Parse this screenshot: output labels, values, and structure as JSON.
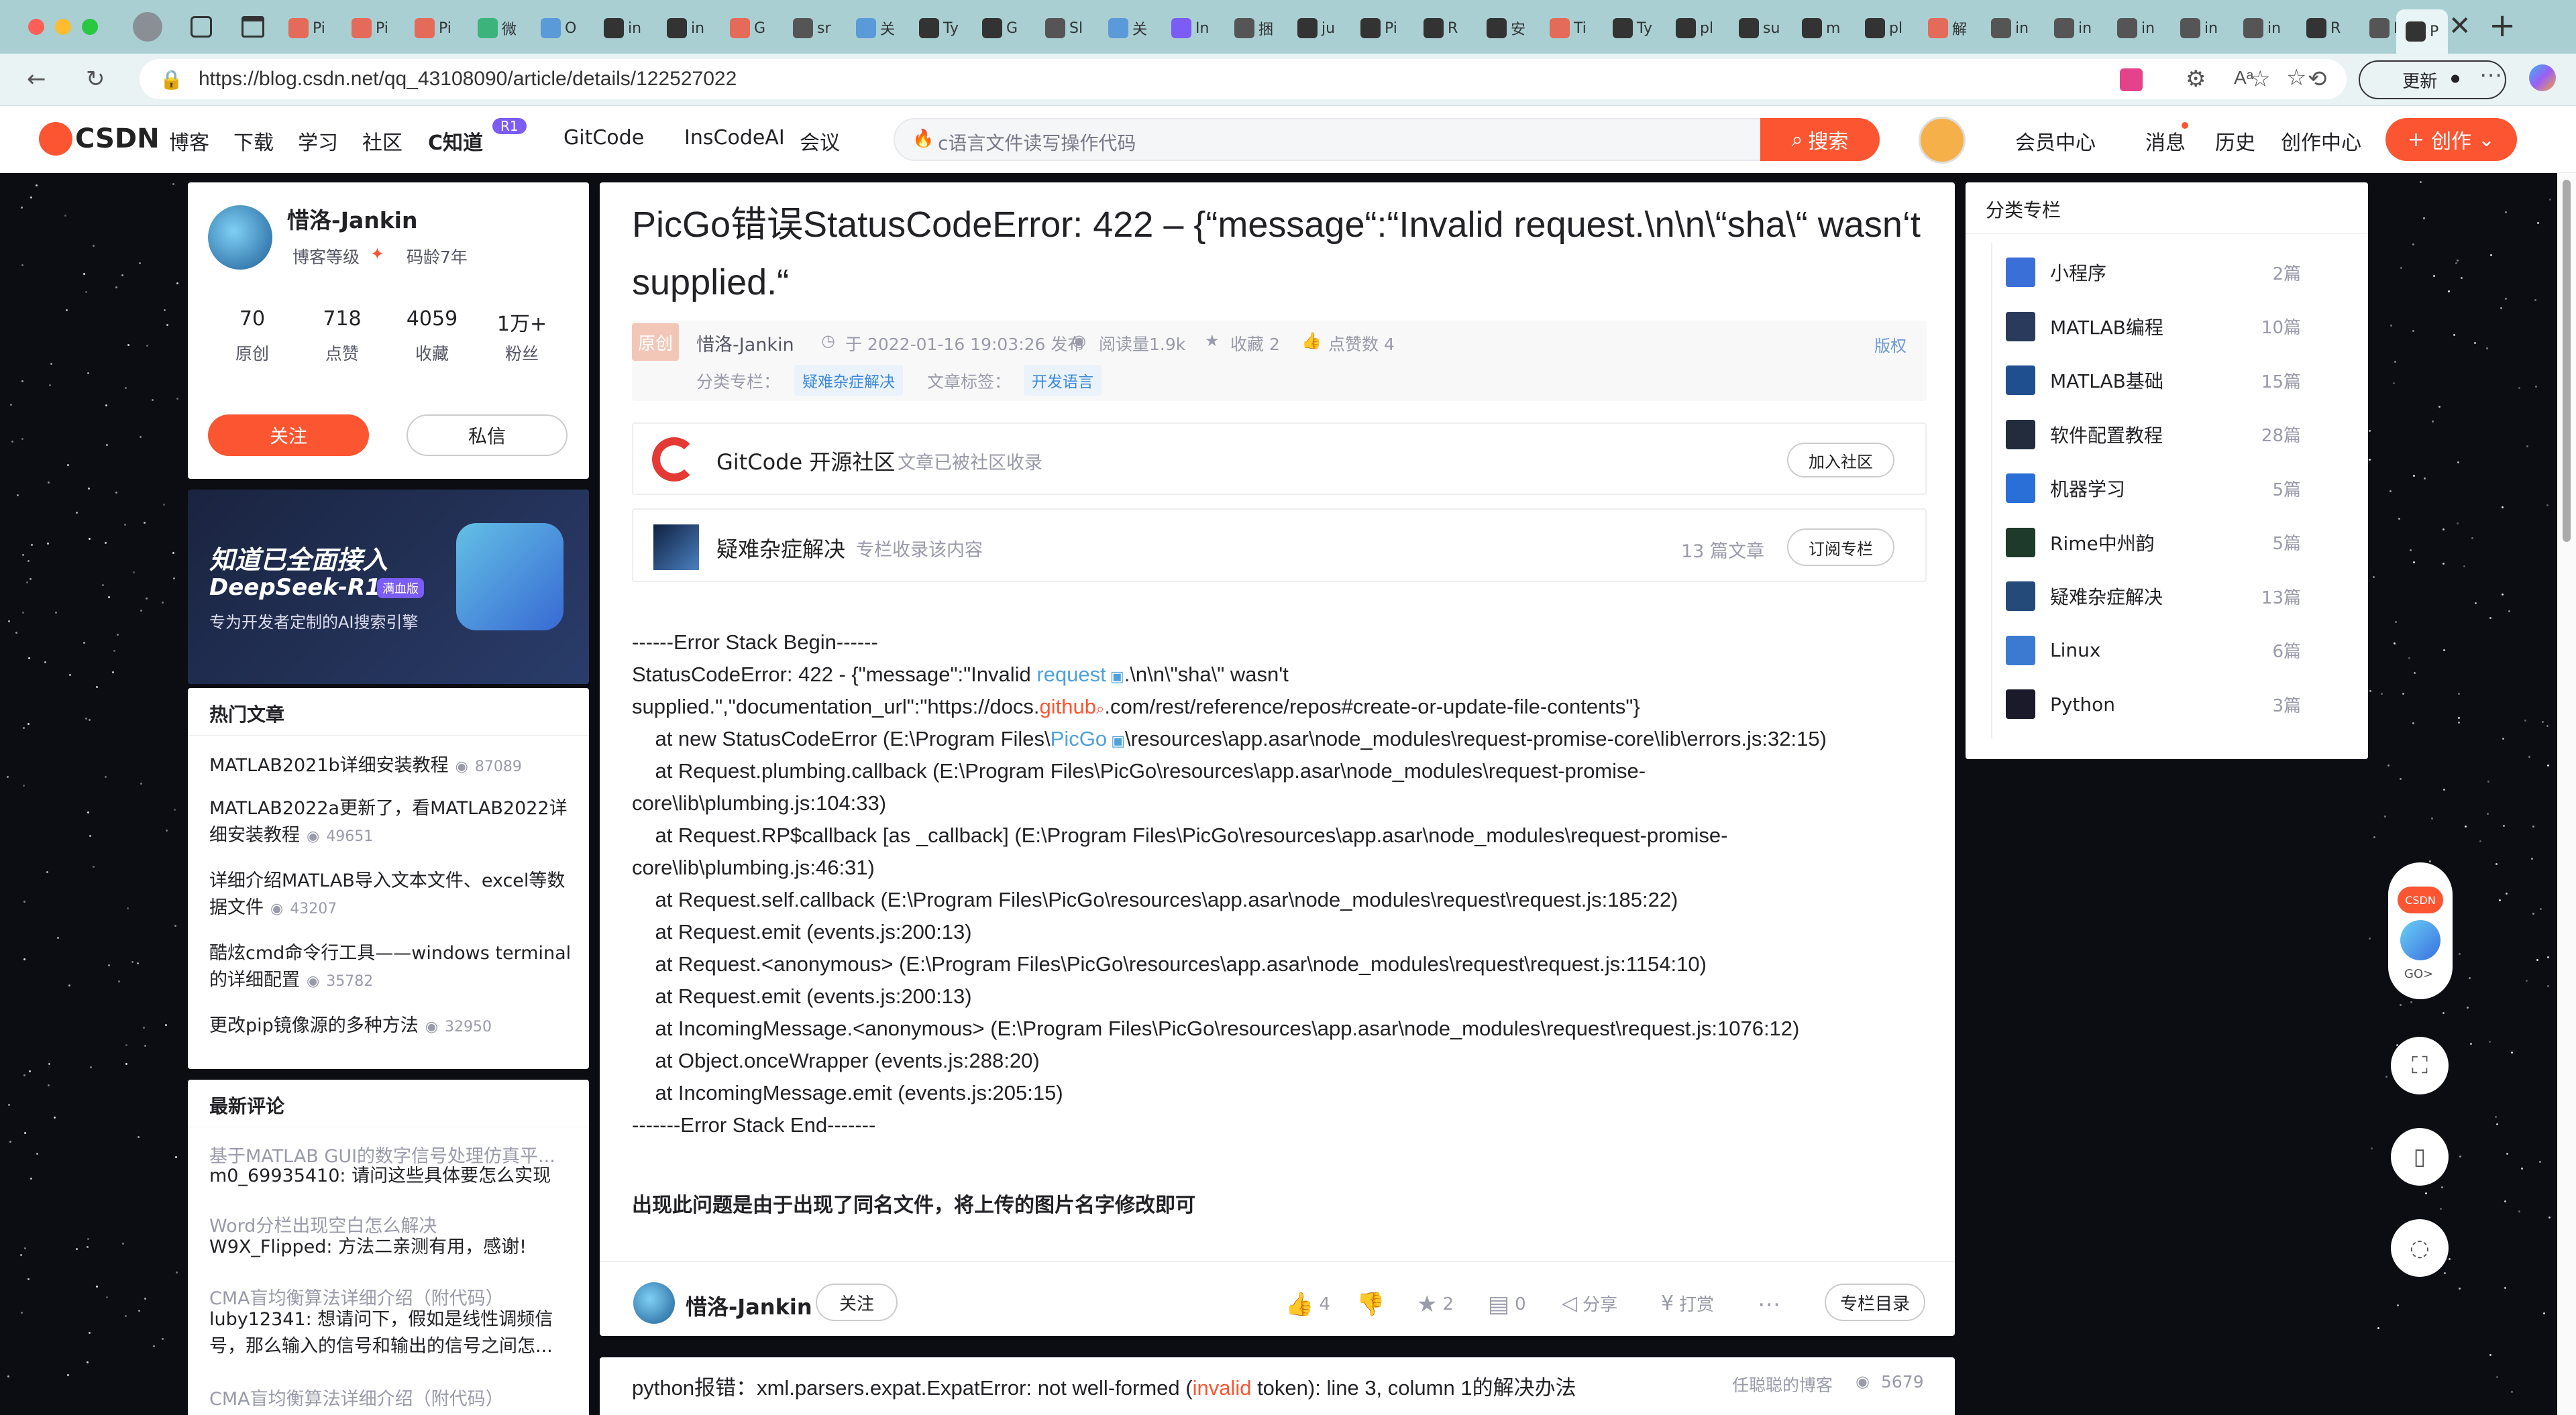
{
  "browser": {
    "tabs": [
      "Pi",
      "Pi",
      "Pi",
      "微",
      "O",
      "in",
      "in",
      "G",
      "sr",
      "关",
      "Ty",
      "G",
      "Sl",
      "关",
      "In",
      "捆",
      "ju",
      "Pi",
      "R",
      "安",
      "Ti",
      "Ty",
      "pl",
      "su",
      "m",
      "pl",
      "解",
      "in",
      "in",
      "in",
      "in",
      "in",
      "R",
      "In",
      "P"
    ],
    "url": "https://blog.csdn.net/qq_43108090/article/details/122527022",
    "update_label": "更新"
  },
  "toolbar": {
    "logo": "CSDN",
    "nav": [
      "博客",
      "下载",
      "学习",
      "社区",
      "C知道",
      "GitCode",
      "InsCodeAI",
      "会议"
    ],
    "r1_badge": "R1",
    "search_placeholder": "c语言文件读写操作代码",
    "search_btn": "搜索",
    "right": [
      "会员中心",
      "消息",
      "历史",
      "创作中心"
    ],
    "create_btn": "创作"
  },
  "profile": {
    "name": "惜洛-Jankin",
    "level": "博客等级",
    "age": "码龄7年",
    "stats": [
      {
        "num": "70",
        "label": "原创"
      },
      {
        "num": "718",
        "label": "点赞"
      },
      {
        "num": "4059",
        "label": "收藏"
      },
      {
        "num": "1万+",
        "label": "粉丝"
      }
    ],
    "follow": "关注",
    "message": "私信"
  },
  "ad": {
    "line1": "知道已全面接入",
    "line2": "DeepSeek-R1",
    "badge": "满血版",
    "line3": "专为开发者定制的AI搜索引擎"
  },
  "hot": {
    "title": "热门文章",
    "items": [
      {
        "title": "MATLAB2021b详细安装教程",
        "views": "87089"
      },
      {
        "title": "MATLAB2022a更新了，看MATLAB2022详细安装教程",
        "views": "49651"
      },
      {
        "title": "详细介绍MATLAB导入文本文件、excel等数据文件",
        "views": "43207"
      },
      {
        "title": "酷炫cmd命令行工具——windows terminal的详细配置",
        "views": "35782"
      },
      {
        "title": "更改pip镜像源的多种方法",
        "views": "32950"
      }
    ]
  },
  "comments": {
    "title": "最新评论",
    "items": [
      {
        "article": "基于MATLAB GUI的数字信号处理仿真平...",
        "text": "m0_69935410: 请问这些具体要怎么实现"
      },
      {
        "article": "Word分栏出现空白怎么解决",
        "text": "W9X_Flipped: 方法二亲测有用，感谢!"
      },
      {
        "article": "CMA盲均衡算法详细介绍（附代码）",
        "text": "luby12341: 想请问下，假如是线性调频信号，那么输入的信号和输出的信号之间怎..."
      },
      {
        "article": "CMA盲均衡算法详细介绍（附代码）",
        "text": ""
      }
    ]
  },
  "article": {
    "title": "PicGo错误StatusCodeError: 422 – {“message“:“Invalid request.\\n\\n\\“sha\\“ wasn‘t supplied.“",
    "original_tag": "原创",
    "author": "惜洛-Jankin",
    "date": "于 2022-01-16 19:03:26 发布",
    "reads": "阅读量1.9k",
    "favorites": "收藏 2",
    "likes": "点赞数 4",
    "copyright": "版权",
    "column_label": "分类专栏：",
    "column_tag": "疑难杂症解决",
    "tag_label": "文章标签：",
    "tag": "开发语言",
    "gitcode_name": "GitCode 开源社区",
    "gitcode_desc": "文章已被社区收录",
    "gitcode_btn": "加入社区",
    "col_name": "疑难杂症解决",
    "col_desc": "专栏收录该内容",
    "col_count": "13 篇文章",
    "col_btn": "订阅专栏",
    "code": {
      "l1": "------Error Stack Begin------",
      "l2a": "StatusCodeError: 422 - {\"message\":\"Invalid ",
      "l2b": "request",
      "l2c": ".\\n\\n\\\"sha\\\" wasn't",
      "l3a": "supplied.\",\"documentation_url\":\"https://docs.",
      "l3b": "github",
      "l3c": ".com/rest/reference/repos#create-or-update-file-contents\"}",
      "l4a": "    at new StatusCodeError (E:\\Program Files\\",
      "l4b": "PicGo",
      "l4c": "\\resources\\app.asar\\node_modules\\request-promise-core\\lib\\errors.js:32:15)",
      "l5": "    at Request.plumbing.callback (E:\\Program Files\\PicGo\\resources\\app.asar\\node_modules\\request-promise-",
      "l6": "core\\lib\\plumbing.js:104:33)",
      "l7": "    at Request.RP$callback [as _callback] (E:\\Program Files\\PicGo\\resources\\app.asar\\node_modules\\request-promise-",
      "l8": "core\\lib\\plumbing.js:46:31)",
      "l9": "    at Request.self.callback (E:\\Program Files\\PicGo\\resources\\app.asar\\node_modules\\request\\request.js:185:22)",
      "l10": "    at Request.emit (events.js:200:13)",
      "l11": "    at Request.<anonymous> (E:\\Program Files\\PicGo\\resources\\app.asar\\node_modules\\request\\request.js:1154:10)",
      "l12": "    at Request.emit (events.js:200:13)",
      "l13": "    at IncomingMessage.<anonymous> (E:\\Program Files\\PicGo\\resources\\app.asar\\node_modules\\request\\request.js:1076:12)",
      "l14": "    at Object.onceWrapper (events.js:288:20)",
      "l15": "    at IncomingMessage.emit (events.js:205:15)",
      "l16": "-------Error Stack End-------"
    },
    "conclusion": "出现此问题是由于出现了同名文件，将上传的图片名字修改即可"
  },
  "footer_bar": {
    "author": "惜洛-Jankin",
    "follow": "关注",
    "likes": "4",
    "favs": "2",
    "comments": "0",
    "share": "分享",
    "reward": "打赏",
    "toc": "专栏目录"
  },
  "related": {
    "title_a": "python报错：xml.parsers.expat.ExpatError: not well-formed (",
    "title_b": "invalid",
    "title_c": " token): line 3, column 1的解决办法",
    "author": "任聪聪的博客",
    "views": "5679"
  },
  "categories": {
    "title": "分类专栏",
    "items": [
      {
        "name": "小程序",
        "count": "2篇",
        "color": "#3b6fd8"
      },
      {
        "name": "MATLAB编程",
        "count": "10篇",
        "color": "#2a3a5a"
      },
      {
        "name": "MATLAB基础",
        "count": "15篇",
        "color": "#1f4f8f"
      },
      {
        "name": "软件配置教程",
        "count": "28篇",
        "color": "#222c3c"
      },
      {
        "name": "机器学习",
        "count": "5篇",
        "color": "#2a6fd8"
      },
      {
        "name": "Rime中州韵",
        "count": "5篇",
        "color": "#1d3a2a"
      },
      {
        "name": "疑难杂症解决",
        "count": "13篇",
        "color": "#244a7a"
      },
      {
        "name": "Linux",
        "count": "6篇",
        "color": "#3a7ad0"
      },
      {
        "name": "Python",
        "count": "3篇",
        "color": "#1a1a2a"
      }
    ]
  },
  "floating": {
    "go": "GO>",
    "csdn": "CSDN"
  }
}
